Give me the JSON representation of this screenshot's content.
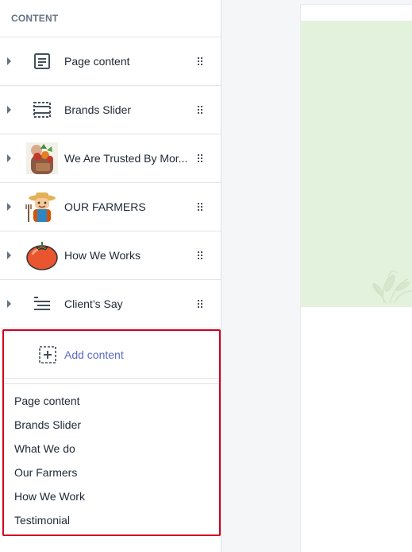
{
  "sidebar": {
    "header": "CONTENT",
    "items": [
      {
        "label": "Page content",
        "icon": "page-content-icon"
      },
      {
        "label": "Brands Slider",
        "icon": "slider-frame-icon"
      },
      {
        "label": "We Are Trusted By Mor...",
        "icon": "produce-basket-image"
      },
      {
        "label": "OUR FARMERS",
        "icon": "farmer-image"
      },
      {
        "label": "How We Works",
        "icon": "tomato-image"
      },
      {
        "label": "Client’s Say",
        "icon": "text-lines-icon"
      }
    ],
    "add_content": {
      "label": "Add content",
      "icon": "add-section-icon",
      "options": [
        "Page content",
        "Brands Slider",
        "What We do",
        "Our Farmers",
        "How We Work",
        "Testimonial"
      ]
    }
  },
  "colors": {
    "accent": "#5c6ac4",
    "highlight_border": "#d1001f",
    "preview_hero": "#e3f2dd"
  }
}
